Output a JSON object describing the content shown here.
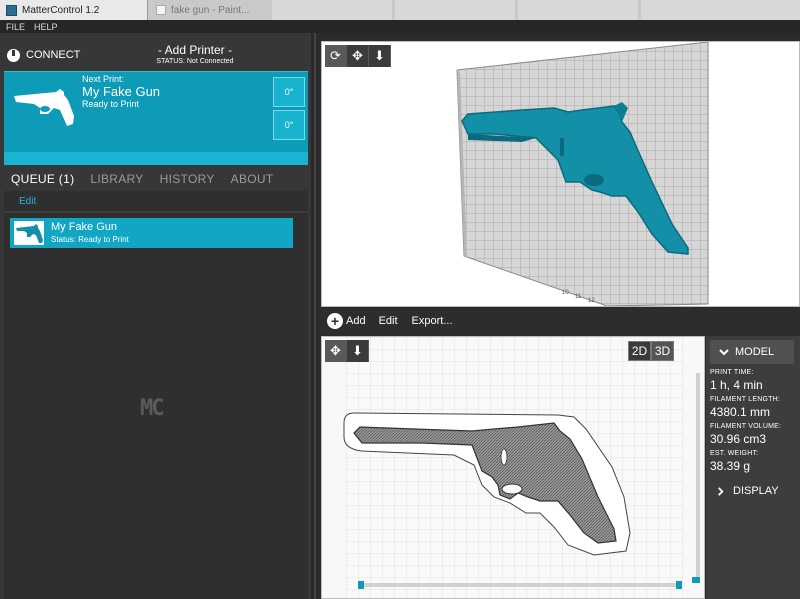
{
  "window": {
    "title": "MatterControl 1.2",
    "bg_tab_title": "fake gun - Paint..."
  },
  "menu": {
    "file": "FILE",
    "help": "HELP"
  },
  "connect": {
    "label": "CONNECT",
    "printer_title": "- Add Printer -",
    "printer_status": "STATUS: Not Connected"
  },
  "next_print": {
    "label": "Next Print:",
    "name": "My Fake Gun",
    "status": "Ready to Print",
    "extruder_temp": "0°",
    "bed_temp": "0°"
  },
  "tabs": [
    {
      "label": "QUEUE (1)",
      "active": true
    },
    {
      "label": "LIBRARY",
      "active": false
    },
    {
      "label": "HISTORY",
      "active": false
    },
    {
      "label": "ABOUT",
      "active": false
    }
  ],
  "queue": {
    "edit_label": "Edit",
    "items": [
      {
        "name": "My Fake Gun",
        "status": "Status: Ready to Print"
      }
    ],
    "logo": "MC"
  },
  "view3d": {
    "tools": [
      "rotate-icon",
      "move-icon",
      "zoom-icon"
    ],
    "grid_labels": [
      "10",
      "11",
      "12"
    ]
  },
  "toolbar": {
    "add_label": "Add",
    "edit_label": "Edit",
    "export_label": "Export..."
  },
  "view2d": {
    "toggle_2d": "2D",
    "toggle_3d": "3D"
  },
  "stats": {
    "model_label": "MODEL",
    "print_time_label": "PRINT TIME:",
    "print_time": "1 h, 4 min",
    "filament_length_label": "FILAMENT LENGTH:",
    "filament_length": "4380.1 mm",
    "filament_volume_label": "FILAMENT VOLUME:",
    "filament_volume": "30.96 cm3",
    "weight_label": "EST. WEIGHT:",
    "weight": "38.39 g",
    "display_label": "DISPLAY"
  },
  "colors": {
    "accent": "#0e9bb7",
    "accent_light": "#19b4d2",
    "model_teal": "#138fa7",
    "panel_dark": "#373737"
  }
}
